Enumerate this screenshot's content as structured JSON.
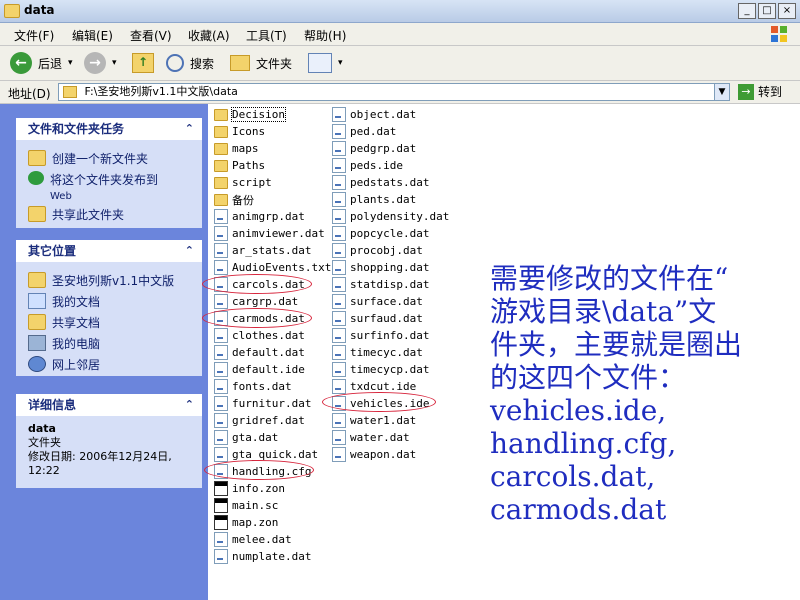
{
  "window": {
    "title": "data",
    "min": "_",
    "max": "□",
    "close": "×"
  },
  "menu": [
    "文件(F)",
    "编辑(E)",
    "查看(V)",
    "收藏(A)",
    "工具(T)",
    "帮助(H)"
  ],
  "toolbar": {
    "back": "后退",
    "search": "搜索",
    "folders": "文件夹"
  },
  "address": {
    "label": "地址(D)",
    "path": "F:\\圣安地列斯v1.1中文版\\data",
    "go": "转到"
  },
  "tasks": {
    "title": "文件和文件夹任务",
    "items": [
      "创建一个新文件夹",
      "将这个文件夹发布到",
      "Web",
      "共享此文件夹"
    ]
  },
  "places": {
    "title": "其它位置",
    "items": [
      "圣安地列斯v1.1中文版",
      "我的文档",
      "共享文档",
      "我的电脑",
      "网上邻居"
    ]
  },
  "details": {
    "title": "详细信息",
    "name": "data",
    "type": "文件夹",
    "modified": "修改日期: 2006年12月24日,",
    "time": "12:22"
  },
  "files_col1": [
    "Decision",
    "Icons",
    "maps",
    "Paths",
    "script",
    "备份",
    "animgrp.dat",
    "animviewer.dat",
    "ar_stats.dat",
    "AudioEvents.txt",
    "carcols.dat",
    "cargrp.dat",
    "carmods.dat",
    "clothes.dat",
    "default.dat",
    "default.ide",
    "fonts.dat",
    "furnitur.dat",
    "gridref.dat",
    "gta.dat",
    "gta_quick.dat",
    "handling.cfg",
    "info.zon",
    "main.sc",
    "map.zon",
    "melee.dat",
    "numplate.dat"
  ],
  "files_col2": [
    "object.dat",
    "ped.dat",
    "pedgrp.dat",
    "peds.ide",
    "pedstats.dat",
    "plants.dat",
    "polydensity.dat",
    "popcycle.dat",
    "procobj.dat",
    "shopping.dat",
    "statdisp.dat",
    "surface.dat",
    "surfaud.dat",
    "surfinfo.dat",
    "timecyc.dat",
    "timecycp.dat",
    "txdcut.ide",
    "vehicles.ide",
    "water1.dat",
    "water.dat",
    "weapon.dat"
  ],
  "annotation": [
    "需要修改的文件在“",
    "游戏目录\\data”文",
    "件夹，主要就是圈出",
    "的这四个文件：",
    "vehicles.ide,",
    "handling.cfg,",
    "carcols.dat,",
    "carmods.dat"
  ]
}
